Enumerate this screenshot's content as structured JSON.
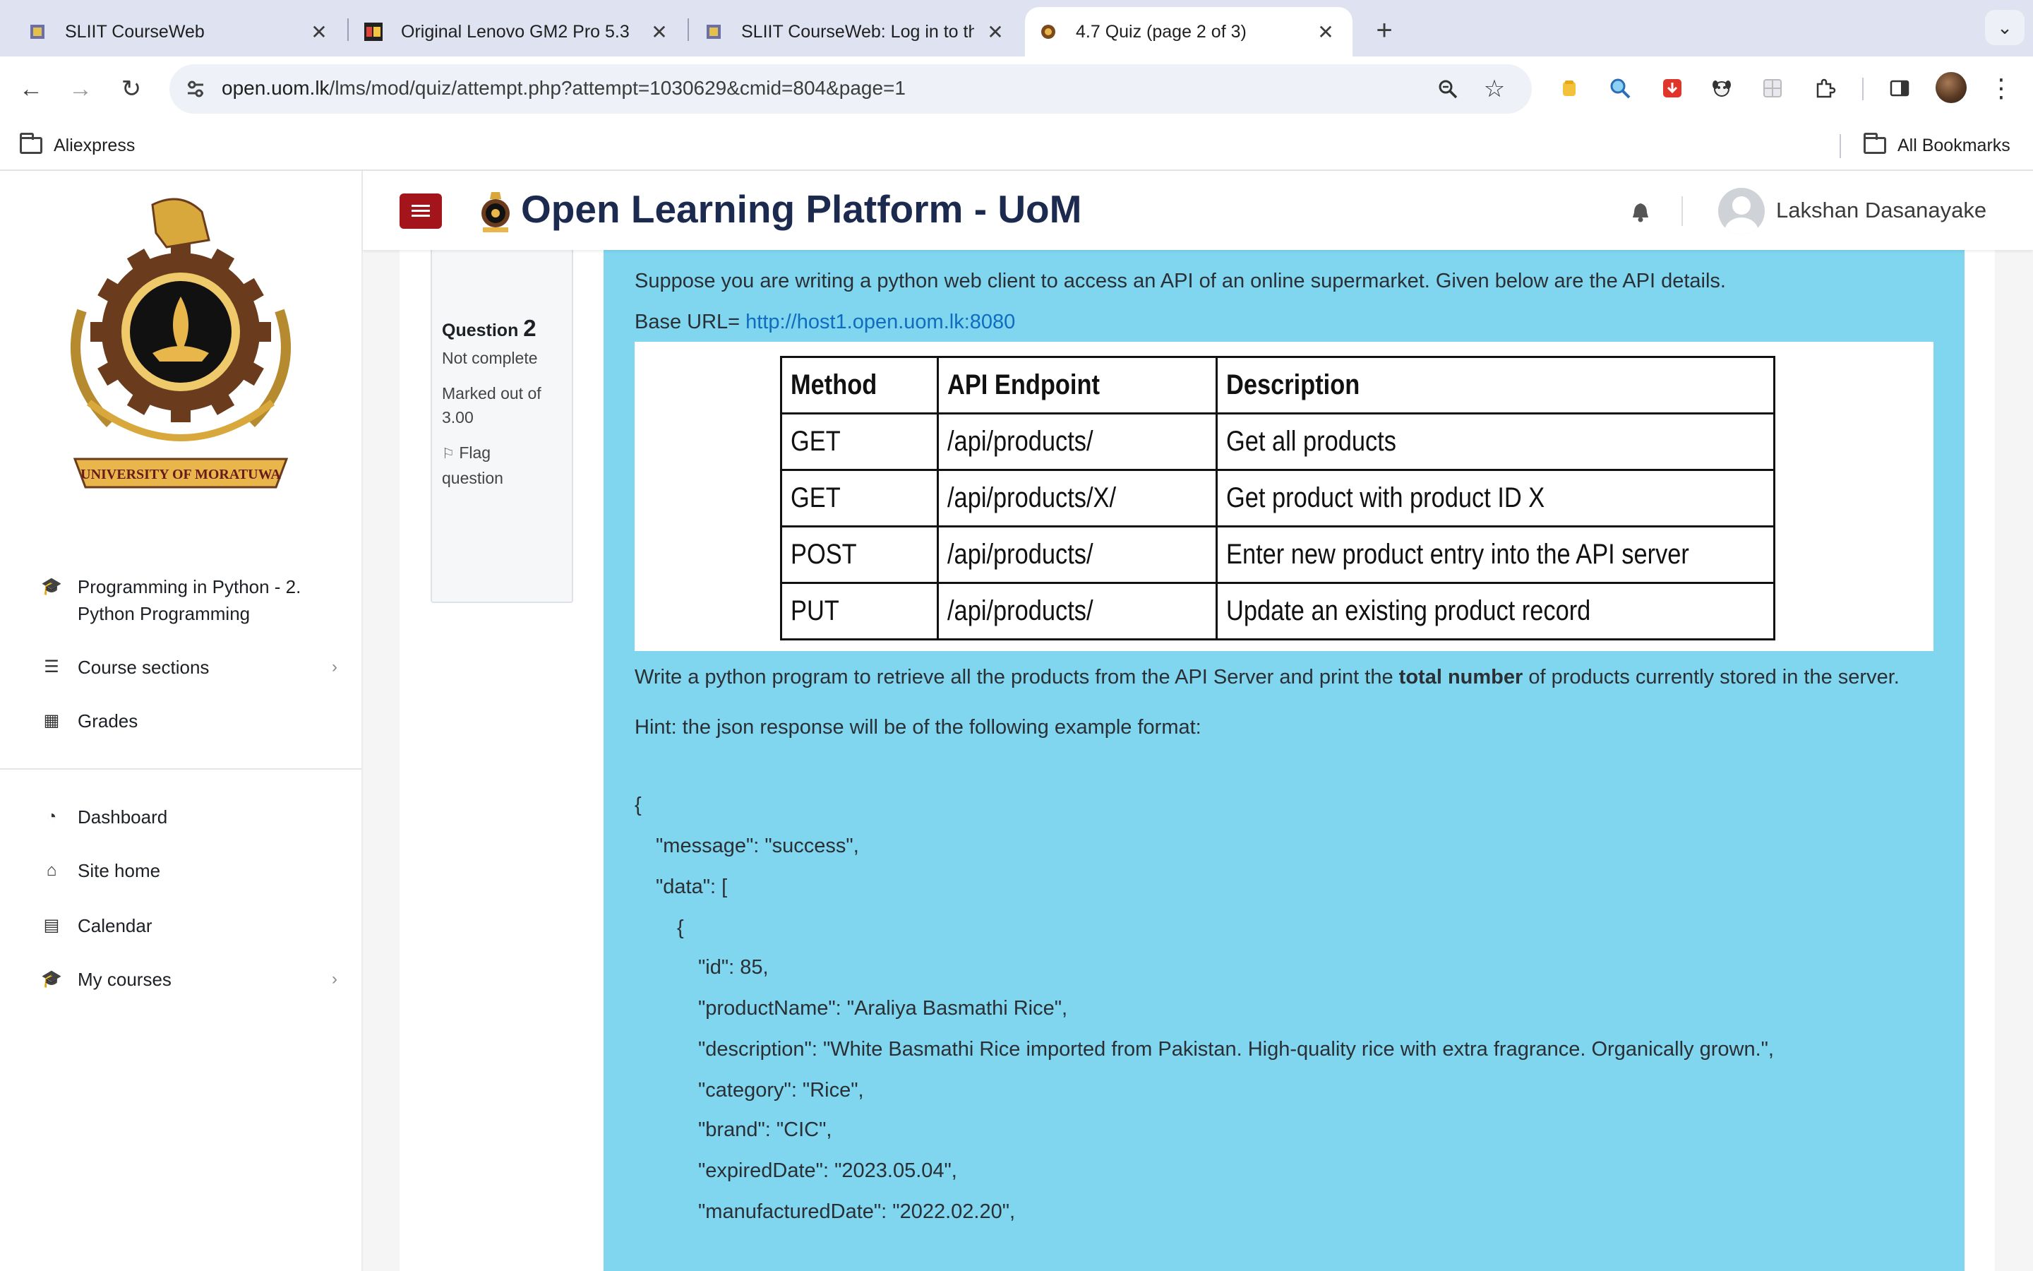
{
  "browser": {
    "tabs": [
      {
        "title": "SLIIT CourseWeb",
        "favicon": "university-crest-icon"
      },
      {
        "title": "Original Lenovo GM2 Pro 5.3",
        "favicon": "aliexpress-icon"
      },
      {
        "title": "SLIIT CourseWeb: Log in to th",
        "favicon": "university-crest-icon"
      },
      {
        "title": "4.7 Quiz (page 2 of 3)",
        "favicon": "uom-emblem-icon"
      }
    ],
    "url_host": "open.uom.lk",
    "url_path": "/lms/mod/quiz/attempt.php?attempt=1030629&cmid=804&page=1",
    "bookmarks": [
      {
        "label": "Aliexpress"
      },
      {
        "label": "All Bookmarks"
      }
    ]
  },
  "site": {
    "title": "Open Learning Platform - UoM",
    "user_name": "Lakshan Dasanayake",
    "colors": {
      "brand_red": "#a3151a",
      "question_bg": "#7fd6ee",
      "navy": "#1b2a4e"
    }
  },
  "drawer": {
    "logo_text": "UNIVERSITY OF MORATUWA",
    "course_items": [
      {
        "label": "Programming in Python - 2. Python Programming",
        "icon": "graduation-cap-icon"
      },
      {
        "label": "Course sections",
        "icon": "list-icon"
      },
      {
        "label": "Grades",
        "icon": "table-icon"
      }
    ],
    "site_items": [
      {
        "label": "Dashboard",
        "icon": "dashboard-icon"
      },
      {
        "label": "Site home",
        "icon": "home-icon"
      },
      {
        "label": "Calendar",
        "icon": "calendar-icon"
      },
      {
        "label": "My courses",
        "icon": "graduation-cap-icon"
      }
    ]
  },
  "question_info": {
    "label": "Question",
    "number": "2",
    "status": "Not complete",
    "marked_out_of_label": "Marked out of",
    "marked_out_of_value": "3.00",
    "flag_line1": "Flag",
    "flag_line2": "question"
  },
  "question": {
    "intro": "Suppose you are writing a python web client to access an API of an online supermarket. Given below are the API details.",
    "base_url_label": "Base URL= ",
    "base_url": "http://host1.open.uom.lk:8080",
    "api_table": {
      "headers": [
        "Method",
        "API Endpoint",
        "Description"
      ],
      "rows": [
        [
          "GET",
          "/api/products/",
          "Get all products"
        ],
        [
          "GET",
          "/api/products/X/",
          "Get product with product ID X"
        ],
        [
          "POST",
          "/api/products/",
          "Enter new product entry into the API server"
        ],
        [
          "PUT",
          "/api/products/",
          "Update an existing product record"
        ]
      ]
    },
    "task_before": "Write a python program to retrieve all the products from the API Server and print the ",
    "task_bold": "total number",
    "task_after": " of products currently stored in the server.",
    "hint": "Hint: the json response will be of the following example format:",
    "json_lines": [
      "{",
      "\"message\": \"success\",",
      "\"data\": [",
      "{",
      "\"id\": 85,",
      "\"productName\": \"Araliya Basmathi Rice\",",
      "\"description\": \"White Basmathi Rice imported from Pakistan. High-quality rice with extra fragrance. Organically grown.\",",
      "\"category\": \"Rice\",",
      "\"brand\": \"CIC\",",
      "\"expiredDate\": \"2023.05.04\",",
      "\"manufacturedDate\": \"2022.02.20\","
    ]
  }
}
